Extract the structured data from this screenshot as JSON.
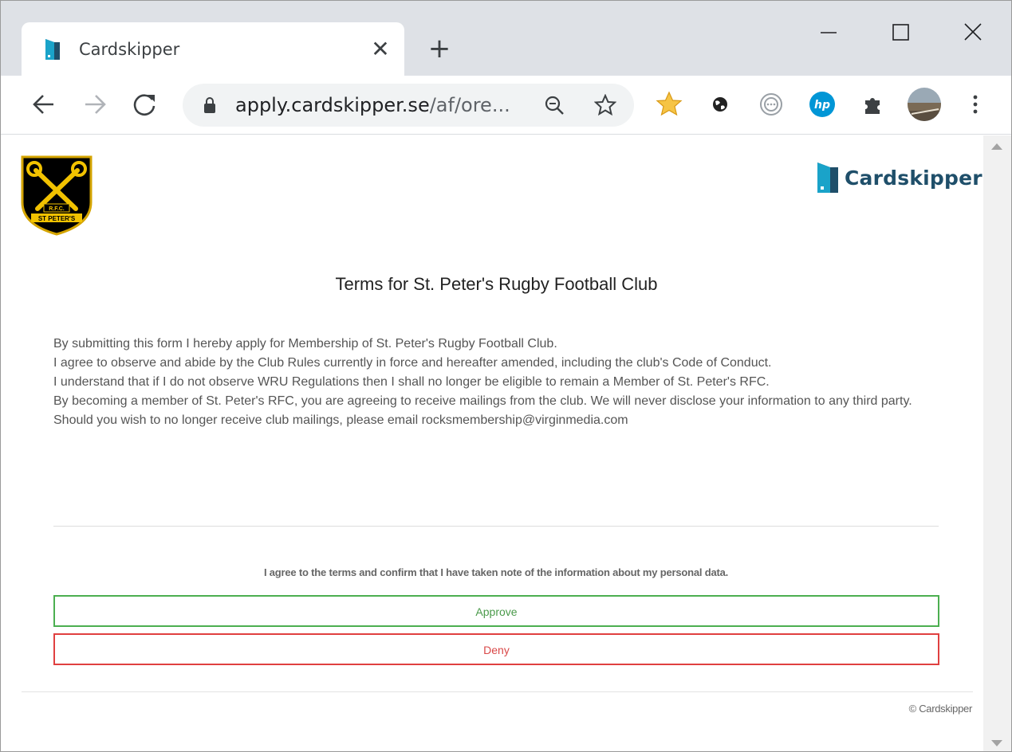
{
  "browser": {
    "tab": {
      "title": "Cardskipper",
      "close_glyph": "✕"
    },
    "new_tab_glyph": "+",
    "window_controls": [
      "minimize-icon",
      "maximize-icon",
      "close-icon"
    ],
    "address": {
      "host": "apply.cardskipper.se",
      "path": "/af/ore..."
    },
    "extensions": [
      "favorites-star-icon",
      "globe-extension-icon",
      "podcast-extension-icon",
      "hp-extension-icon",
      "puzzle-extensions-icon",
      "profile-avatar-icon",
      "menu-kebab-icon"
    ]
  },
  "page": {
    "brand_name": "Cardskipper",
    "club_logo": {
      "text_top": "R.F.C.",
      "text_bottom": "ST PETER'S",
      "colors": {
        "shield": "#000000",
        "border": "#d4a400",
        "keys": "#f2c200"
      }
    },
    "terms_title": "Terms for St. Peter's Rugby Football Club",
    "terms_paragraphs": [
      "By submitting this form I hereby apply for Membership of St. Peter's Rugby Football Club.",
      "I agree to observe and abide by the Club Rules currently in force and hereafter amended, including the club's Code of Conduct.",
      "I understand that if I do not observe WRU Regulations then I shall no longer be eligible to remain a Member of St. Peter's RFC.",
      "By becoming a member of St. Peter's RFC, you are agreeing to receive mailings from the club. We will never disclose your information to any third party. Should you wish to no longer receive club mailings, please email rocksmembership@virginmedia.com"
    ],
    "agree_text": "I agree to the terms and confirm that I have taken note of the information about my personal data.",
    "approve_label": "Approve",
    "deny_label": "Deny",
    "copyright": "© Cardskipper"
  },
  "colors": {
    "approve": "#4caf50",
    "deny": "#e04040",
    "brand": "#1f4f6a",
    "brand_accent": "#1aa3c9"
  }
}
